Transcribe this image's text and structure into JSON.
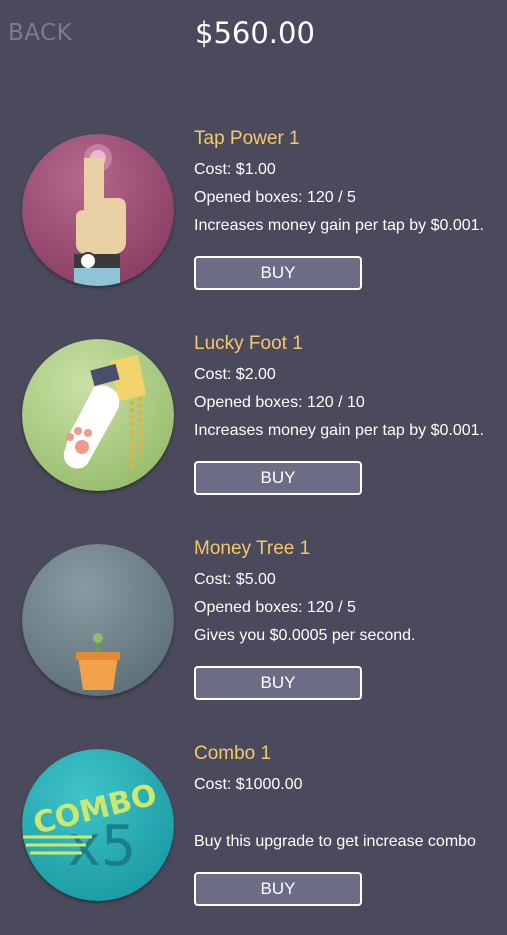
{
  "header": {
    "back_label": "BACK",
    "balance": "$560.00"
  },
  "items": [
    {
      "title": "Tap Power 1",
      "cost": "Cost: $1.00",
      "opened": "Opened boxes: 120 / 5",
      "description": "Increases money gain per tap by $0.001.",
      "buy_label": "BUY",
      "icon": "tap-hand-icon"
    },
    {
      "title": "Lucky Foot 1",
      "cost": "Cost: $2.00",
      "opened": "Opened boxes: 120 / 10",
      "description": "Increases money gain per tap by $0.001.",
      "buy_label": "BUY",
      "icon": "lucky-paw-icon"
    },
    {
      "title": "Money Tree 1",
      "cost": "Cost: $5.00",
      "opened": "Opened boxes: 120 / 5",
      "description": "Gives you $0.0005 per second.",
      "buy_label": "BUY",
      "icon": "money-tree-icon"
    },
    {
      "title": "Combo 1",
      "cost": "Cost: $1000.00",
      "opened": "",
      "description": "Buy this upgrade to get increase combo",
      "buy_label": "BUY",
      "icon": "combo-icon",
      "icon_text": "COMBO",
      "icon_multiplier": "x5"
    }
  ],
  "colors": {
    "background": "#4a4a5c",
    "title": "#f4c96b",
    "button": "#6c6c87"
  }
}
